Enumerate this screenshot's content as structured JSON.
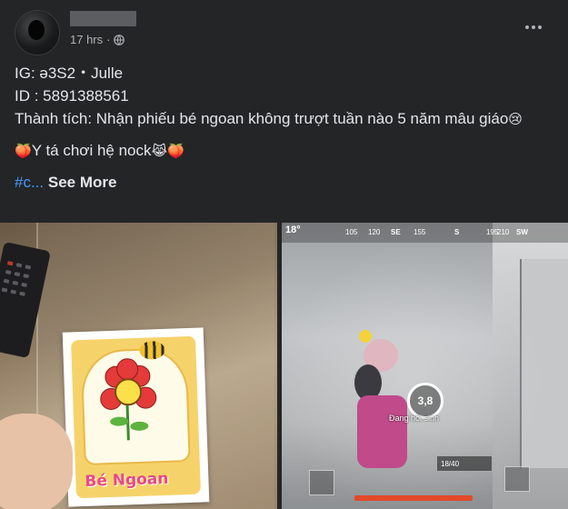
{
  "post": {
    "timestamp": "17 hrs",
    "separator": "·",
    "lines": [
      "IG: ə3S2・Julle",
      "ID : 5891388561",
      "Thành tích: Nhận phiếu bé ngoan không trượt tuần nào 5 năm mâu giáo"
    ],
    "line_emoji": "😢",
    "second_para": "Y tá chơi hệ nock",
    "peach": "🍑",
    "cat_emoji": "😹",
    "hashtag": "#c...",
    "see_more": "See More"
  },
  "photo_left": {
    "card_text": "Bé Ngoan"
  },
  "photo_right": {
    "compass": [
      "105",
      "120",
      "SE",
      "155",
      "S",
      "195",
      "210",
      "SW"
    ],
    "ping": "18°",
    "revive_countdown": "3,8",
    "revive_text": "Đang hồi sinh",
    "ammo_text": "18/40"
  },
  "icons": {
    "globe": "globe-icon",
    "more": "more-horizontal-icon"
  }
}
